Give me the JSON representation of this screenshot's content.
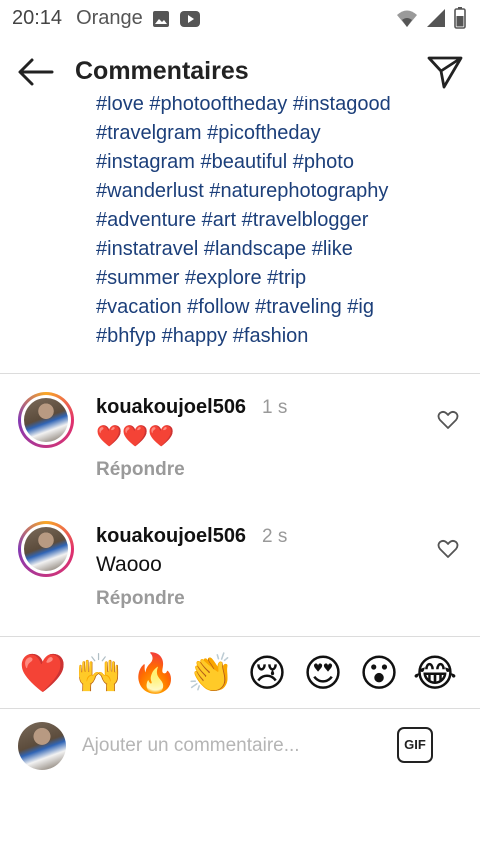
{
  "status_bar": {
    "time": "20:14",
    "carrier": "Orange"
  },
  "header": {
    "title": "Commentaires"
  },
  "caption": {
    "lines": [
      "#love #photooftheday #instagood",
      "#travelgram #picoftheday",
      "#instagram #beautiful #photo",
      "#wanderlust #naturephotography",
      "#adventure #art #travelblogger",
      "#instatravel #landscape #like",
      "#summer #explore #trip",
      "#vacation #follow #traveling #ig",
      "#bhfyp #happy #fashion"
    ],
    "color": "#1c3f7a"
  },
  "comments": [
    {
      "username": "kouakoujoel506",
      "time": "1 s",
      "text": "❤️❤️❤️",
      "reply_label": "Répondre"
    },
    {
      "username": "kouakoujoel506",
      "time": "2 s",
      "text": "Waooo",
      "reply_label": "Répondre"
    }
  ],
  "quick_emojis": [
    "❤️",
    "🙌",
    "🔥",
    "👏",
    "😢",
    "😍",
    "😮",
    "😂"
  ],
  "composer": {
    "placeholder": "Ajouter un commentaire...",
    "gif_label": "GIF"
  },
  "colors": {
    "hashtag": "#1c3f7a",
    "secondary_text": "#999999",
    "story_ring": "#e1306c"
  }
}
